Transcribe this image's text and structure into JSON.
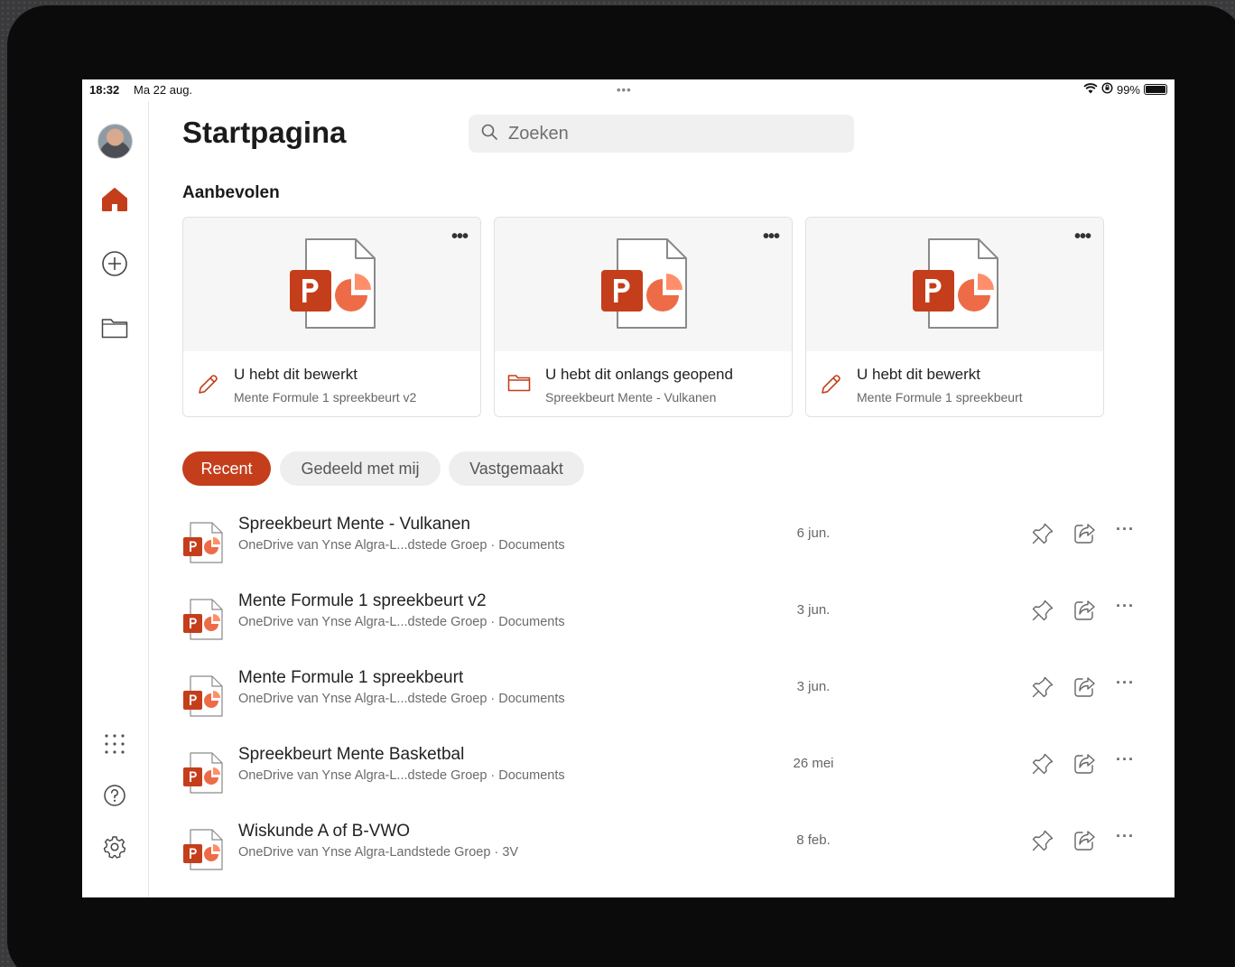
{
  "status_bar": {
    "time": "18:32",
    "date": "Ma 22 aug.",
    "dots": "•••",
    "battery": "99%",
    "battery_level": 0.99
  },
  "header": {
    "title": "Startpagina",
    "search_placeholder": "Zoeken"
  },
  "sidebar": {
    "items": [
      {
        "icon": "home-icon",
        "active": true
      },
      {
        "icon": "add-circle-icon",
        "active": false
      },
      {
        "icon": "folder-icon",
        "active": false
      },
      {
        "icon": "apps-grid-icon",
        "active": false
      },
      {
        "icon": "help-icon",
        "active": false
      },
      {
        "icon": "settings-icon",
        "active": false
      }
    ]
  },
  "recommended": {
    "title": "Aanbevolen",
    "more_label": "•••",
    "cards": [
      {
        "action": "U hebt dit bewerkt",
        "file": "Mente Formule 1 spreekbeurt v2",
        "icon": "pencil-icon"
      },
      {
        "action": "U hebt dit onlangs geopend",
        "file": "Spreekbeurt Mente - Vulkanen",
        "icon": "folder-icon"
      },
      {
        "action": "U hebt dit bewerkt",
        "file": "Mente Formule 1 spreekbeurt",
        "icon": "pencil-icon"
      }
    ]
  },
  "tabs": [
    {
      "label": "Recent",
      "active": true
    },
    {
      "label": "Gedeeld met mij",
      "active": false
    },
    {
      "label": "Vastgemaakt",
      "active": false
    }
  ],
  "files": [
    {
      "name": "Spreekbeurt Mente - Vulkanen",
      "location": "OneDrive van Ynse Algra-L...dstede Groep · Documents",
      "date": "6 jun."
    },
    {
      "name": "Mente Formule 1 spreekbeurt v2",
      "location": "OneDrive van Ynse Algra-L...dstede Groep · Documents",
      "date": "3 jun."
    },
    {
      "name": "Mente Formule 1 spreekbeurt",
      "location": "OneDrive van Ynse Algra-L...dstede Groep · Documents",
      "date": "3 jun."
    },
    {
      "name": "Spreekbeurt Mente Basketbal",
      "location": "OneDrive van Ynse Algra-L...dstede Groep · Documents",
      "date": "26 mei"
    },
    {
      "name": "Wiskunde A of B-VWO",
      "location": "OneDrive van Ynse Algra-Landstede Groep · 3V",
      "date": "8 feb."
    }
  ],
  "row_more_label": "···",
  "colors": {
    "accent": "#c43e1c",
    "ppt_red": "#c43e1c",
    "ppt_pie": "#ed6c47"
  }
}
